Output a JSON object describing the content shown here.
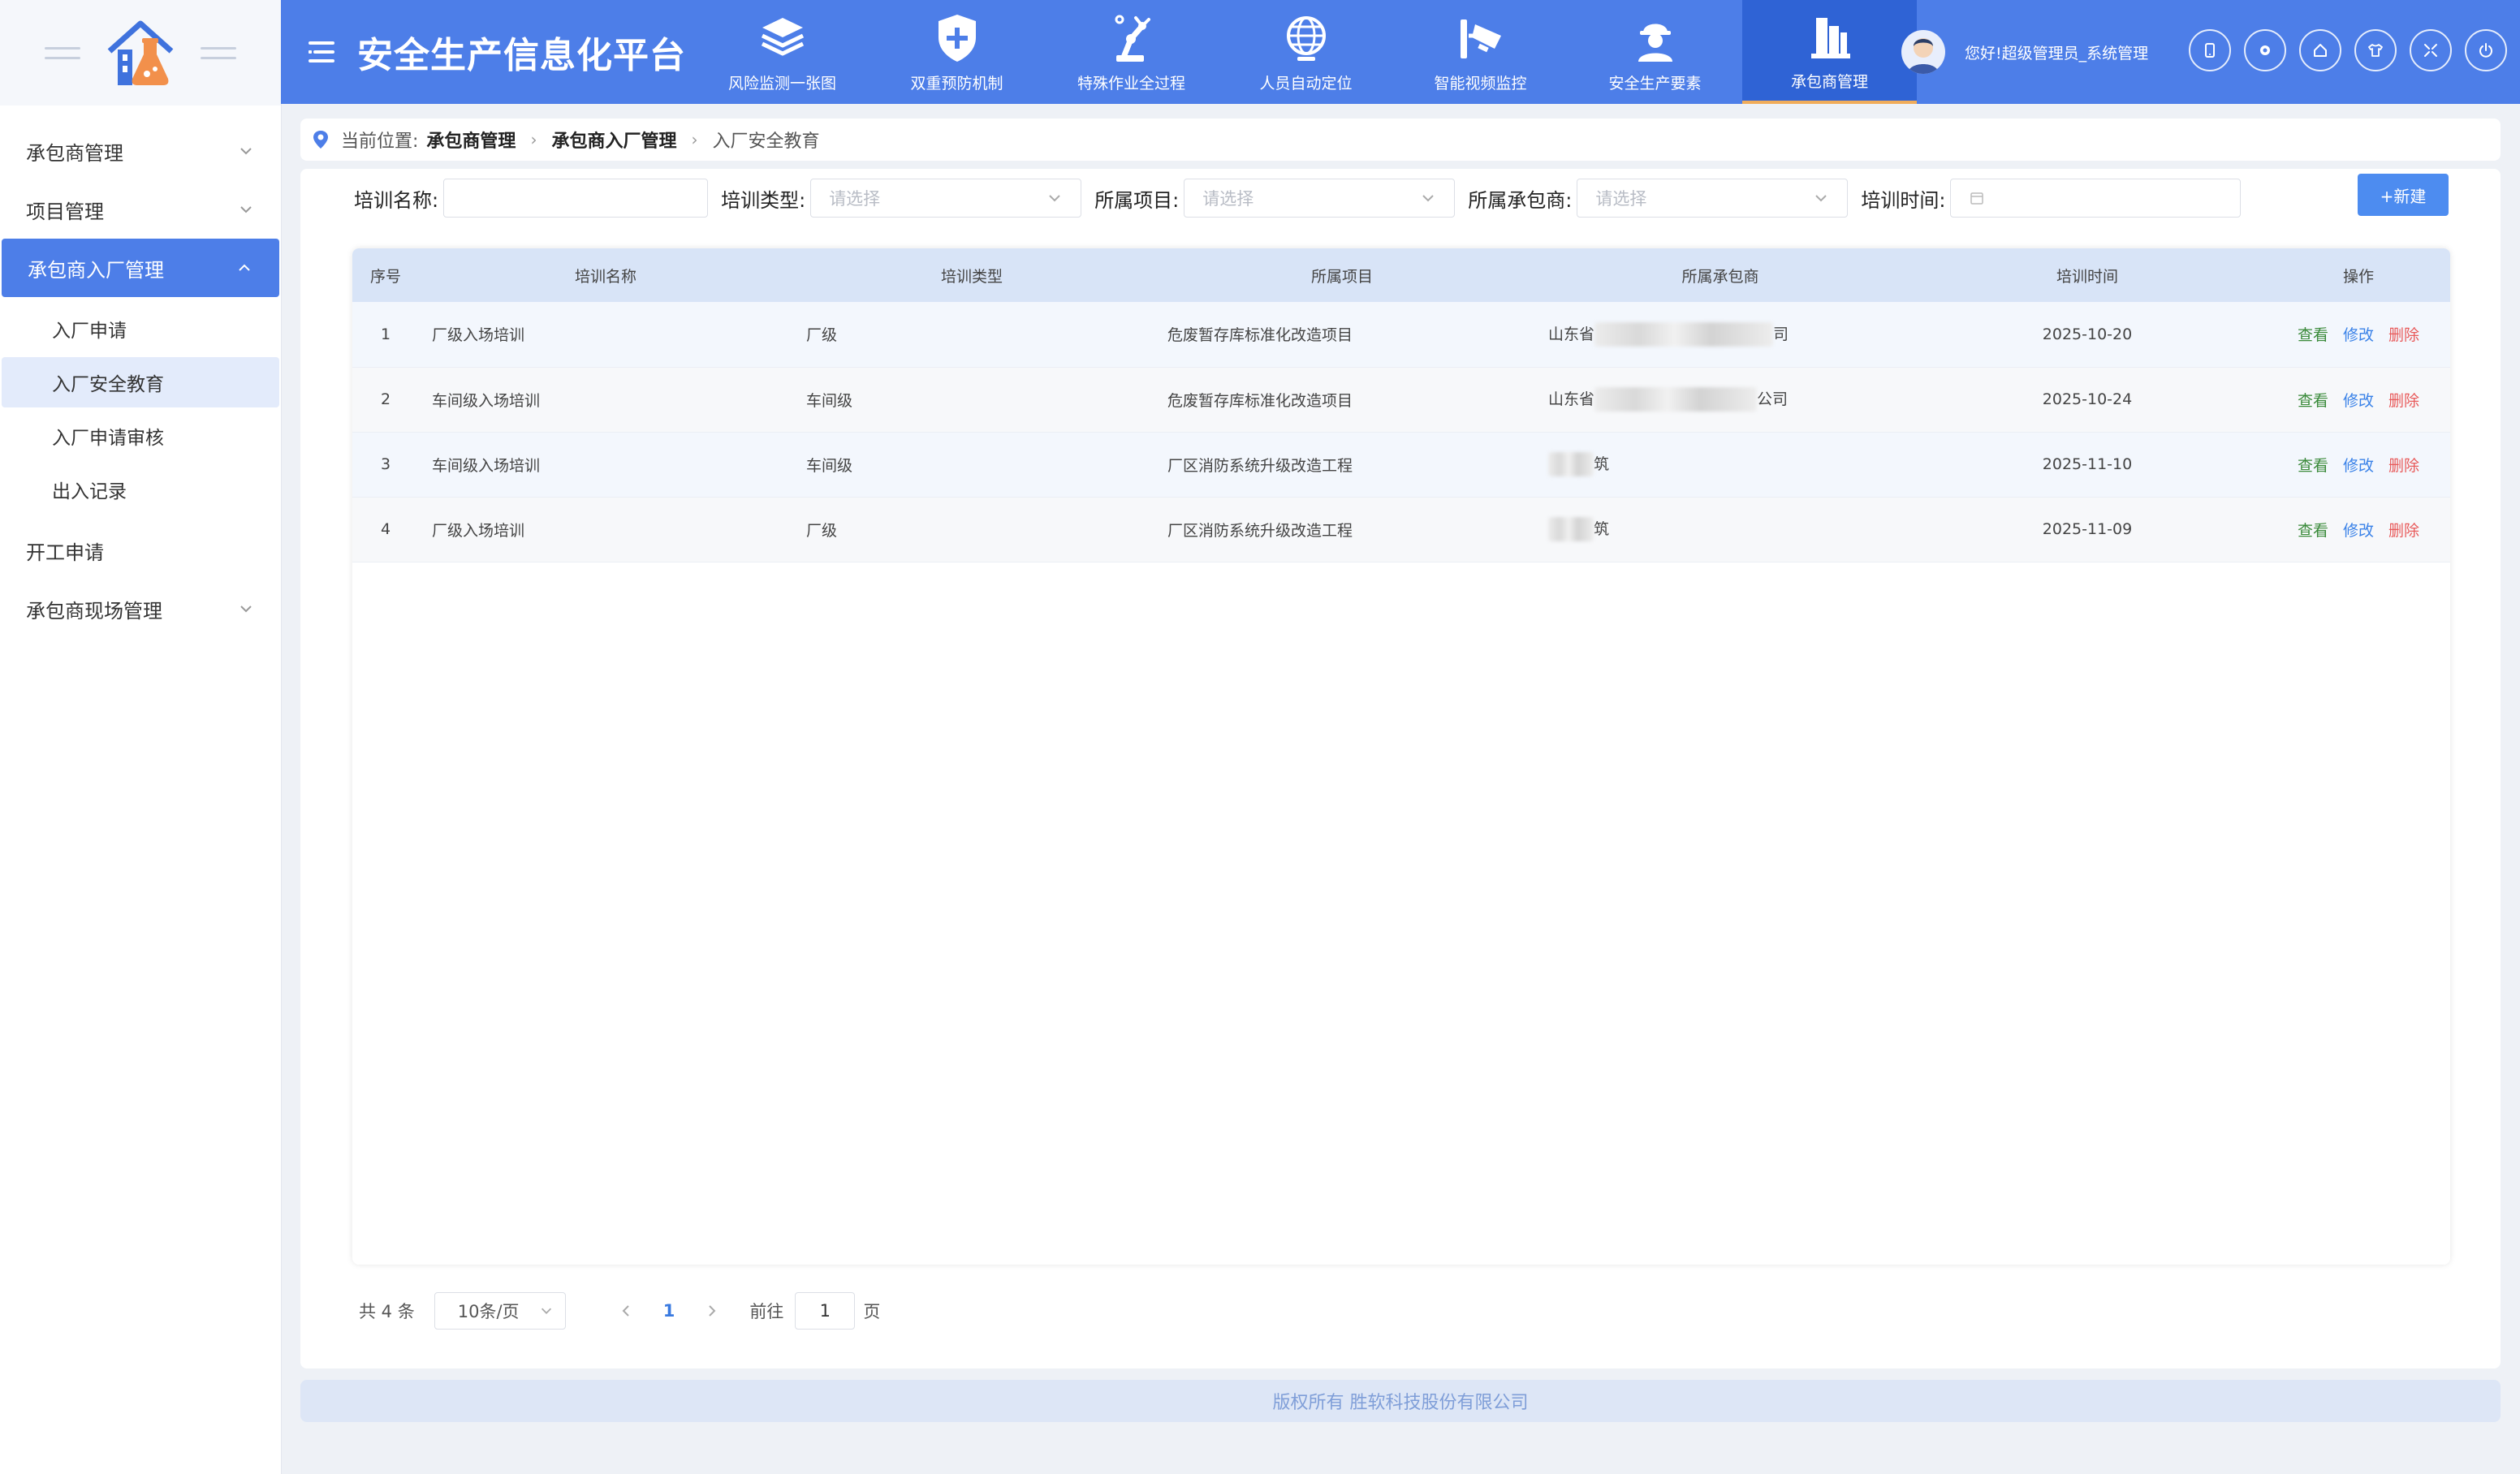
{
  "app": {
    "title": "安全生产信息化平台"
  },
  "colors": {
    "primary": "#4d7ee8",
    "nav_active": "#2f63d5",
    "view": "#3a8a3a",
    "edit": "#3a82e8",
    "delete": "#e85a5a"
  },
  "top_nav": [
    {
      "label": "风险监测一张图",
      "icon": "layers-icon"
    },
    {
      "label": "双重预防机制",
      "icon": "shield-plus-icon"
    },
    {
      "label": "特殊作业全过程",
      "icon": "robot-arm-icon"
    },
    {
      "label": "人员自动定位",
      "icon": "globe-icon"
    },
    {
      "label": "智能视频监控",
      "icon": "camera-icon"
    },
    {
      "label": "安全生产要素",
      "icon": "worker-icon"
    },
    {
      "label": "承包商管理",
      "icon": "building-icon",
      "active": true
    }
  ],
  "user": {
    "greeting": "您好!超级管理员_系统管理"
  },
  "toolbar_icons": [
    "tablet-icon",
    "settings-icon",
    "home-icon",
    "shirt-icon",
    "fullscreen-icon",
    "power-icon"
  ],
  "sidebar": {
    "items": [
      {
        "label": "承包商管理"
      },
      {
        "label": "项目管理"
      },
      {
        "label": "承包商入厂管理",
        "active": true,
        "children": [
          {
            "label": "入厂申请"
          },
          {
            "label": "入厂安全教育",
            "active": true
          },
          {
            "label": "入厂申请审核"
          },
          {
            "label": "出入记录"
          }
        ]
      },
      {
        "label": "开工申请"
      },
      {
        "label": "承包商现场管理"
      }
    ]
  },
  "breadcrumb": {
    "prefix": "当前位置:",
    "items": [
      "承包商管理",
      "承包商入厂管理",
      "入厂安全教育"
    ]
  },
  "filters": {
    "name_label": "培训名称:",
    "type_label": "培训类型:",
    "type_placeholder": "请选择",
    "project_label": "所属项目:",
    "project_placeholder": "请选择",
    "contractor_label": "所属承包商:",
    "contractor_placeholder": "请选择",
    "time_label": "培训时间:"
  },
  "new_button": "+新建",
  "table": {
    "columns": [
      "序号",
      "培训名称",
      "培训类型",
      "所属项目",
      "所属承包商",
      "培训时间",
      "操作"
    ],
    "rows": [
      {
        "idx": "1",
        "name": "厂级入场培训",
        "type": "厂级",
        "project": "危废暂存库标准化改造项目",
        "contractor_pre": "山东省",
        "contractor_post": "司",
        "time": "2025-10-20"
      },
      {
        "idx": "2",
        "name": "车间级入场培训",
        "type": "车间级",
        "project": "危废暂存库标准化改造项目",
        "contractor_pre": "山东省",
        "contractor_post": "公司",
        "time": "2025-10-24"
      },
      {
        "idx": "3",
        "name": "车间级入场培训",
        "type": "车间级",
        "project": "厂区消防系统升级改造工程",
        "contractor_pre": "",
        "contractor_post": "筑",
        "time": "2025-11-10"
      },
      {
        "idx": "4",
        "name": "厂级入场培训",
        "type": "厂级",
        "project": "厂区消防系统升级改造工程",
        "contractor_pre": "",
        "contractor_post": "筑",
        "time": "2025-11-09"
      }
    ],
    "actions": {
      "view": "查看",
      "edit": "修改",
      "delete": "删除"
    }
  },
  "pagination": {
    "total": "共 4 条",
    "page_size": "10条/页",
    "current": "1",
    "goto_prefix": "前往",
    "goto_value": "1",
    "goto_suffix": "页"
  },
  "footer": "版权所有 胜软科技股份有限公司"
}
